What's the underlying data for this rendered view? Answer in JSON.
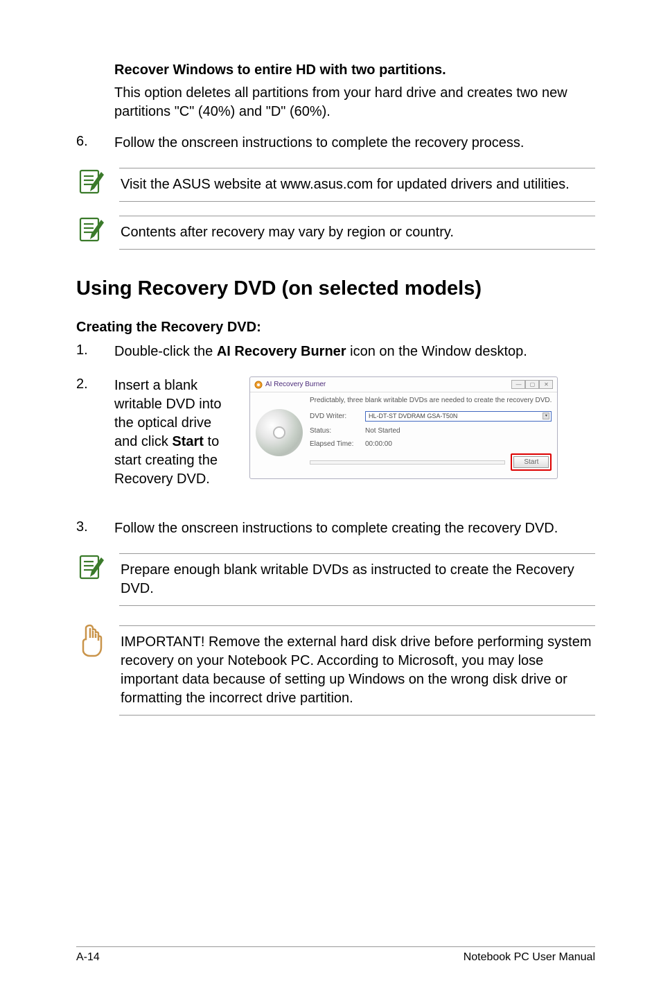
{
  "section1": {
    "title": "Recover Windows to entire HD with two partitions.",
    "desc": "This option deletes all partitions from your hard drive and creates two new partitions \"C\" (40%) and \"D\" (60%)."
  },
  "step6": {
    "num": "6.",
    "text": "Follow the onscreen instructions to complete the recovery process."
  },
  "note1": "Visit the ASUS website at www.asus.com for updated drivers and utilities.",
  "note2": "Contents after recovery may vary by region or country.",
  "heading": "Using Recovery DVD (on selected models)",
  "subheading": "Creating the Recovery DVD:",
  "step1": {
    "num": "1.",
    "text_pre": "Double-click the ",
    "bold": "AI Recovery Burner",
    "text_post": " icon on the Window desktop."
  },
  "step2": {
    "num": "2.",
    "text_pre": "Insert a blank writable DVD into the optical drive and click ",
    "bold": "Start",
    "text_post": " to start creating the Recovery DVD."
  },
  "burner": {
    "title": "AI Recovery Burner",
    "msg": "Predictably, three blank writable DVDs are needed to create the recovery DVD.",
    "writer_label": "DVD Writer:",
    "writer_value": "HL-DT-ST DVDRAM GSA-T50N",
    "status_label": "Status:",
    "status_value": "Not Started",
    "elapsed_label": "Elapsed Time:",
    "elapsed_value": "00:00:00",
    "start_btn": "Start"
  },
  "step3": {
    "num": "3.",
    "text": "Follow the onscreen instructions to complete creating the recovery DVD."
  },
  "note3": "Prepare enough blank writable DVDs as instructed to create the Recovery DVD.",
  "important": "IMPORTANT! Remove the external hard disk drive before performing system recovery on your Notebook PC. According to Microsoft, you may lose important data because of setting up Windows on the wrong disk drive or formatting the incorrect drive partition.",
  "footer": {
    "left": "A-14",
    "right": "Notebook PC User Manual"
  }
}
